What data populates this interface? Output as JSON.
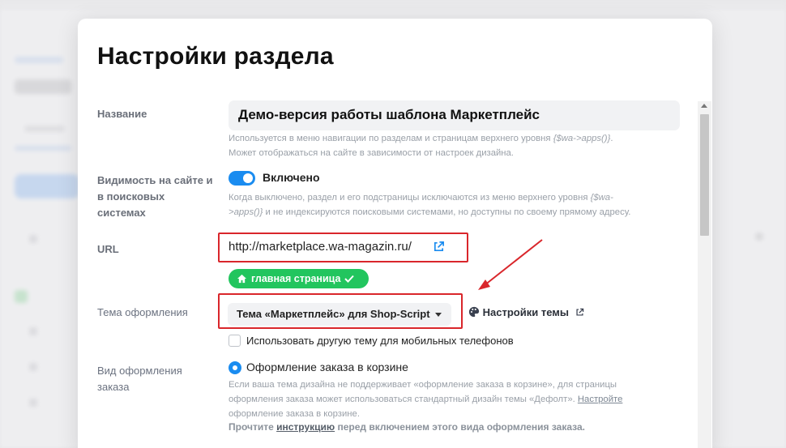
{
  "dialog": {
    "title": "Настройки раздела"
  },
  "fields": {
    "name": {
      "label": "Название",
      "value": "Демо-версия работы шаблона Маркетплейс",
      "hint_line1": "Используется в меню навигации по разделам и страницам верхнего уровня",
      "hint_code": "{$wa->apps()}",
      "hint_line2": "Может отображаться на сайте в зависимости от настроек дизайна."
    },
    "visibility": {
      "label_line1": "Видимость на сайте и",
      "label_line2": "в поисковых",
      "label_line3": "системах",
      "toggle_label": "Включено",
      "toggle_on": true,
      "hint_line1a": "Когда выключено, раздел и его подстраницы исключаются из меню верхнего уровня",
      "hint_code_a": "{$wa-",
      "hint_code_b": ">apps()}",
      "hint_line2": "и не индексируются поисковыми системами, но доступны по своему прямому адресу."
    },
    "url": {
      "label": "URL",
      "value": "http://marketplace.wa-magazin.ru/",
      "open_icon": "external-link-icon",
      "home_badge": "главная страница"
    },
    "theme": {
      "label": "Тема оформления",
      "selected": "Тема «Маркетплейс» для Shop-Script",
      "settings_link": "Настройки темы",
      "mobile_checkbox_label": "Использовать другую тему для мобильных телефонов",
      "mobile_checked": false
    },
    "checkout": {
      "label_line1": "Вид оформления",
      "label_line2": "заказа",
      "option_label": "Оформление заказа в корзине",
      "hint_line1": "Если ваша тема дизайна не поддерживает «оформление заказа в корзине», для страницы",
      "hint_line2a": "оформления заказа может использоваться стандартный дизайн темы «Дефолт».",
      "hint_link": "Настройте",
      "hint_line3": "оформление заказа в корзине.",
      "note_a": "Прочтите",
      "note_link": "инструкцию",
      "note_b": "перед включением этого вида оформления заказа."
    }
  },
  "colors": {
    "accent": "#1a8cf0",
    "success": "#22c55e",
    "annotation": "#d9262b"
  }
}
